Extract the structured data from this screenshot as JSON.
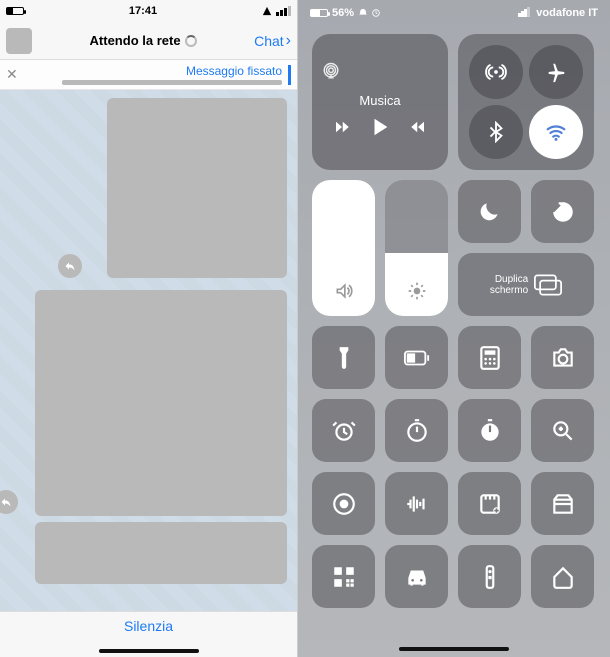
{
  "left_status": {
    "time": "17:41"
  },
  "chat_header": {
    "back_label": "Chat",
    "title": "Attendo la rete"
  },
  "pinned": {
    "label": "Messaggio fissato"
  },
  "footer": {
    "mute_label": "Silenzia"
  },
  "cc_status": {
    "carrier": "vodafone IT",
    "battery_pct": "56%"
  },
  "music": {
    "title": "Musica"
  },
  "mirror": {
    "line1": "Duplica",
    "line2": "schermo"
  },
  "icon_names": {
    "airplane": "airplane-icon",
    "cellular": "cellular-antenna-icon",
    "wifi": "wifi-icon",
    "bluetooth": "bluetooth-icon",
    "airplay": "airplay-icon",
    "prev": "previous-track-icon",
    "play": "play-icon",
    "next": "next-track-icon",
    "lock_rotation": "rotation-lock-icon",
    "dnd": "do-not-disturb-icon",
    "brightness": "brightness-icon",
    "volume": "volume-icon",
    "mirror": "screen-mirroring-icon",
    "flashlight": "flashlight-icon",
    "battery": "low-power-icon",
    "calculator": "calculator-icon",
    "camera": "camera-icon",
    "alarm": "alarm-clock-icon",
    "timer": "timer-icon",
    "stopwatch": "stopwatch-icon",
    "magnifier": "magnifier-icon",
    "record": "screen-record-icon",
    "voice": "voice-memo-icon",
    "notes": "quick-note-icon",
    "wallet": "wallet-icon",
    "qr": "qr-scan-icon",
    "car": "driving-mode-icon",
    "remote": "remote-icon",
    "home": "home-icon"
  }
}
